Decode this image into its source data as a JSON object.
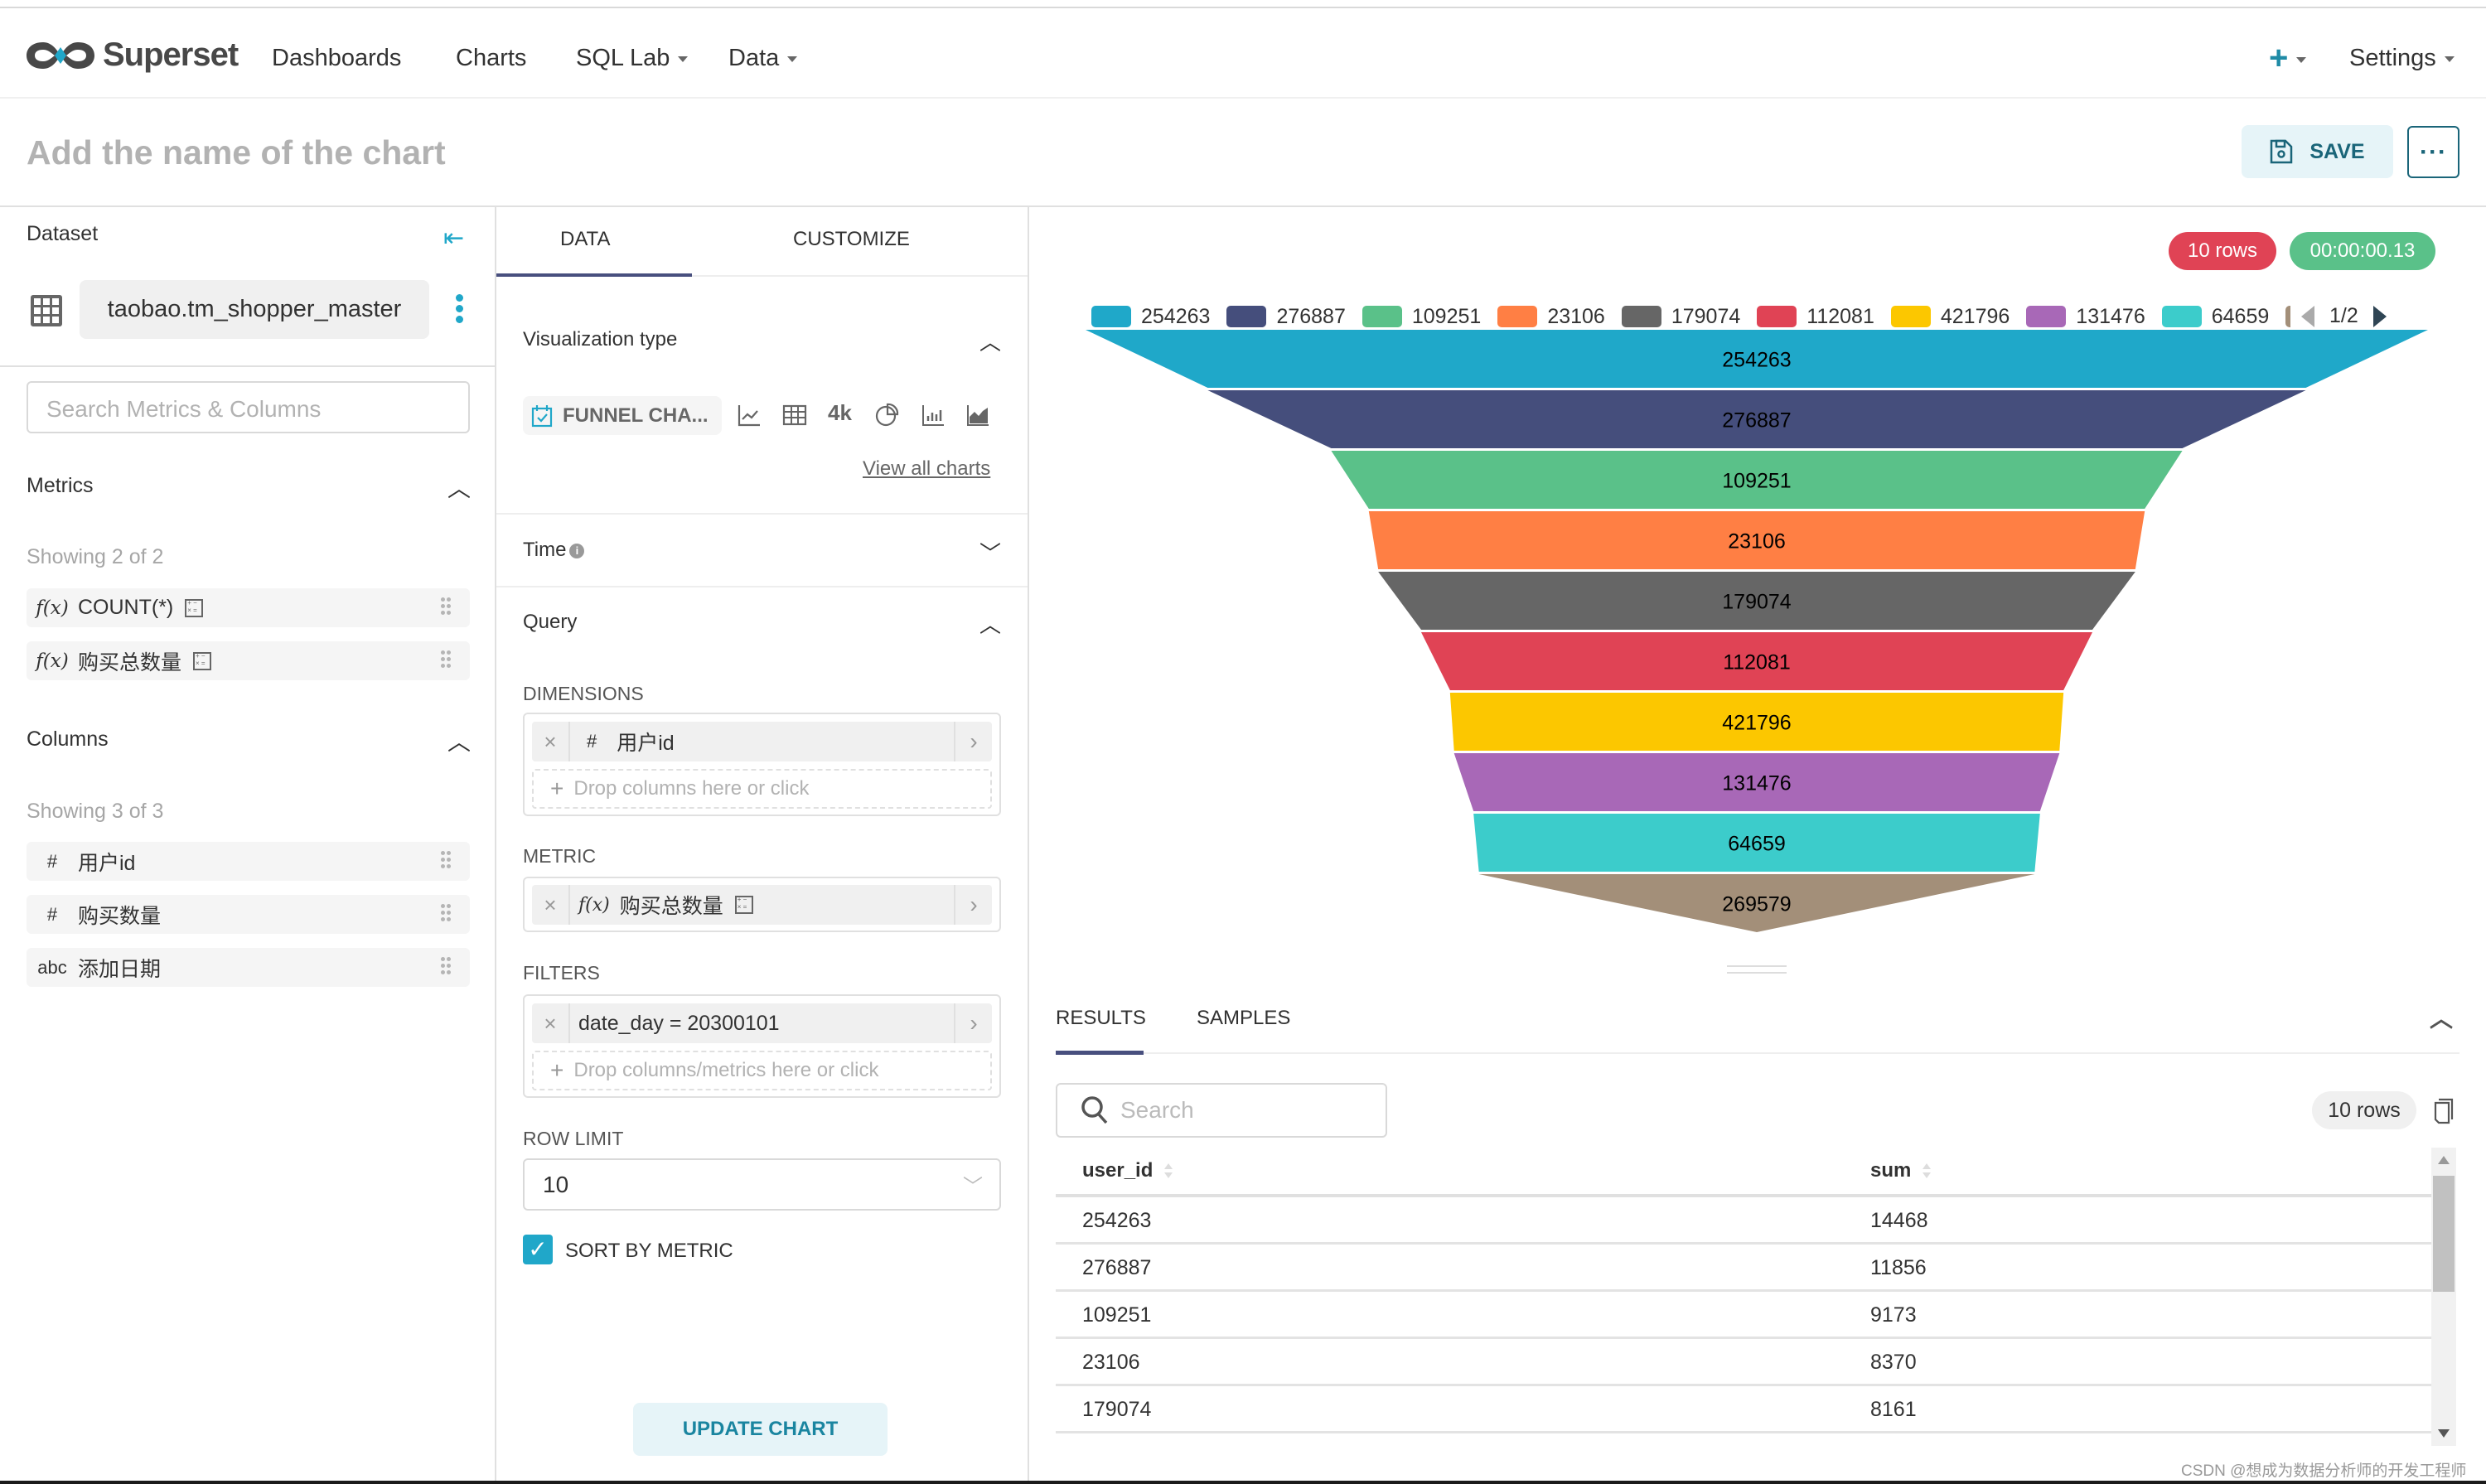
{
  "nav": {
    "brand": "Superset",
    "items": [
      {
        "label": "Dashboards",
        "dropdown": false
      },
      {
        "label": "Charts",
        "dropdown": false
      },
      {
        "label": "SQL Lab",
        "dropdown": true
      },
      {
        "label": "Data",
        "dropdown": true
      }
    ],
    "plus_icon": "plus-icon",
    "settings_label": "Settings"
  },
  "titlebar": {
    "title_placeholder": "Add the name of the chart",
    "save_label": "SAVE",
    "more_label": "···"
  },
  "left_panel": {
    "dataset_label": "Dataset",
    "dataset_name": "taobao.tm_shopper_master",
    "search_placeholder": "Search Metrics & Columns",
    "metrics_label": "Metrics",
    "metrics_count": "Showing 2 of 2",
    "metrics": [
      {
        "type": "f(x)",
        "name": "COUNT(*)"
      },
      {
        "type": "f(x)",
        "name": "购买总数量"
      }
    ],
    "columns_label": "Columns",
    "columns_count": "Showing 3 of 3",
    "columns": [
      {
        "type": "#",
        "name": "用户id"
      },
      {
        "type": "#",
        "name": "购买数量"
      },
      {
        "type": "abc",
        "name": "添加日期"
      }
    ]
  },
  "mid_panel": {
    "tabs": [
      {
        "label": "DATA",
        "active": true
      },
      {
        "label": "CUSTOMIZE",
        "active": false
      }
    ],
    "viz_type_label": "Visualization type",
    "viz_selected": "FUNNEL CHA...",
    "viz_icons": [
      "line-chart-icon",
      "table-icon",
      "big-number-icon",
      "pie-chart-icon",
      "bar-chart-icon",
      "area-chart-icon"
    ],
    "big_number_text": "4k",
    "view_all": "View all charts",
    "time_label": "Time",
    "query_label": "Query",
    "dimensions_label": "DIMENSIONS",
    "dimension_chip": {
      "type": "#",
      "name": "用户id"
    },
    "dimensions_drop": "Drop columns here or click",
    "metric_label": "METRIC",
    "metric_chip": {
      "type": "f(x)",
      "name": "购买总数量"
    },
    "filters_label": "FILTERS",
    "filter_chip": "date_day = 20300101",
    "filters_drop": "Drop columns/metrics here or click",
    "row_limit_label": "ROW LIMIT",
    "row_limit_value": "10",
    "sort_by_metric_label": "SORT BY METRIC",
    "sort_by_metric_checked": true,
    "update_label": "UPDATE CHART"
  },
  "chart_panel": {
    "rows_badge": "10 rows",
    "time_badge": "00:00:00.13",
    "legend_page": "1/2",
    "results_tabs": [
      {
        "label": "RESULTS",
        "active": true
      },
      {
        "label": "SAMPLES",
        "active": false
      }
    ],
    "search_placeholder": "Search",
    "rows_count": "10 rows",
    "table": {
      "columns": [
        "user_id",
        "sum"
      ],
      "rows": [
        [
          "254263",
          "14468"
        ],
        [
          "276887",
          "11856"
        ],
        [
          "109251",
          "9173"
        ],
        [
          "23106",
          "8370"
        ],
        [
          "179074",
          "8161"
        ]
      ]
    }
  },
  "chart_data": {
    "type": "funnel",
    "title": "",
    "dimension": "user_id",
    "metric": "sum",
    "sort": "descending by metric",
    "categories": [
      "254263",
      "276887",
      "109251",
      "23106",
      "179074",
      "112081",
      "421796",
      "131476",
      "64659",
      "269579"
    ],
    "visible_values": [
      14468,
      11856,
      9173,
      8370,
      8161
    ],
    "colors": [
      "#1fa8c9",
      "#454e7c",
      "#5ac189",
      "#ff7f44",
      "#666666",
      "#e04355",
      "#fcc700",
      "#a868b7",
      "#3ccccb",
      "#a38f79"
    ],
    "legend_visible_count": 9,
    "legend_position": "top",
    "data_labels": [
      "254263",
      "276887",
      "109251",
      "23106",
      "179074",
      "112081",
      "421796",
      "131476",
      "64659",
      "269579"
    ]
  },
  "footer": {
    "watermark": "CSDN @想成为数据分析师的开发工程师"
  }
}
